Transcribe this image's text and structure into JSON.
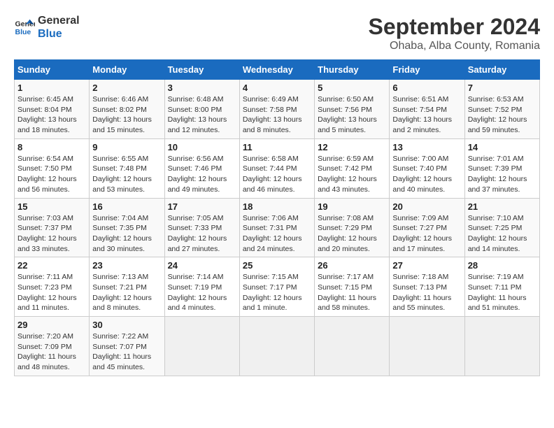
{
  "logo": {
    "line1": "General",
    "line2": "Blue"
  },
  "title": "September 2024",
  "subtitle": "Ohaba, Alba County, Romania",
  "days_header": [
    "Sunday",
    "Monday",
    "Tuesday",
    "Wednesday",
    "Thursday",
    "Friday",
    "Saturday"
  ],
  "weeks": [
    [
      {
        "day": "1",
        "sunrise": "Sunrise: 6:45 AM",
        "sunset": "Sunset: 8:04 PM",
        "daylight": "Daylight: 13 hours and 18 minutes."
      },
      {
        "day": "2",
        "sunrise": "Sunrise: 6:46 AM",
        "sunset": "Sunset: 8:02 PM",
        "daylight": "Daylight: 13 hours and 15 minutes."
      },
      {
        "day": "3",
        "sunrise": "Sunrise: 6:48 AM",
        "sunset": "Sunset: 8:00 PM",
        "daylight": "Daylight: 13 hours and 12 minutes."
      },
      {
        "day": "4",
        "sunrise": "Sunrise: 6:49 AM",
        "sunset": "Sunset: 7:58 PM",
        "daylight": "Daylight: 13 hours and 8 minutes."
      },
      {
        "day": "5",
        "sunrise": "Sunrise: 6:50 AM",
        "sunset": "Sunset: 7:56 PM",
        "daylight": "Daylight: 13 hours and 5 minutes."
      },
      {
        "day": "6",
        "sunrise": "Sunrise: 6:51 AM",
        "sunset": "Sunset: 7:54 PM",
        "daylight": "Daylight: 13 hours and 2 minutes."
      },
      {
        "day": "7",
        "sunrise": "Sunrise: 6:53 AM",
        "sunset": "Sunset: 7:52 PM",
        "daylight": "Daylight: 12 hours and 59 minutes."
      }
    ],
    [
      {
        "day": "8",
        "sunrise": "Sunrise: 6:54 AM",
        "sunset": "Sunset: 7:50 PM",
        "daylight": "Daylight: 12 hours and 56 minutes."
      },
      {
        "day": "9",
        "sunrise": "Sunrise: 6:55 AM",
        "sunset": "Sunset: 7:48 PM",
        "daylight": "Daylight: 12 hours and 53 minutes."
      },
      {
        "day": "10",
        "sunrise": "Sunrise: 6:56 AM",
        "sunset": "Sunset: 7:46 PM",
        "daylight": "Daylight: 12 hours and 49 minutes."
      },
      {
        "day": "11",
        "sunrise": "Sunrise: 6:58 AM",
        "sunset": "Sunset: 7:44 PM",
        "daylight": "Daylight: 12 hours and 46 minutes."
      },
      {
        "day": "12",
        "sunrise": "Sunrise: 6:59 AM",
        "sunset": "Sunset: 7:42 PM",
        "daylight": "Daylight: 12 hours and 43 minutes."
      },
      {
        "day": "13",
        "sunrise": "Sunrise: 7:00 AM",
        "sunset": "Sunset: 7:40 PM",
        "daylight": "Daylight: 12 hours and 40 minutes."
      },
      {
        "day": "14",
        "sunrise": "Sunrise: 7:01 AM",
        "sunset": "Sunset: 7:39 PM",
        "daylight": "Daylight: 12 hours and 37 minutes."
      }
    ],
    [
      {
        "day": "15",
        "sunrise": "Sunrise: 7:03 AM",
        "sunset": "Sunset: 7:37 PM",
        "daylight": "Daylight: 12 hours and 33 minutes."
      },
      {
        "day": "16",
        "sunrise": "Sunrise: 7:04 AM",
        "sunset": "Sunset: 7:35 PM",
        "daylight": "Daylight: 12 hours and 30 minutes."
      },
      {
        "day": "17",
        "sunrise": "Sunrise: 7:05 AM",
        "sunset": "Sunset: 7:33 PM",
        "daylight": "Daylight: 12 hours and 27 minutes."
      },
      {
        "day": "18",
        "sunrise": "Sunrise: 7:06 AM",
        "sunset": "Sunset: 7:31 PM",
        "daylight": "Daylight: 12 hours and 24 minutes."
      },
      {
        "day": "19",
        "sunrise": "Sunrise: 7:08 AM",
        "sunset": "Sunset: 7:29 PM",
        "daylight": "Daylight: 12 hours and 20 minutes."
      },
      {
        "day": "20",
        "sunrise": "Sunrise: 7:09 AM",
        "sunset": "Sunset: 7:27 PM",
        "daylight": "Daylight: 12 hours and 17 minutes."
      },
      {
        "day": "21",
        "sunrise": "Sunrise: 7:10 AM",
        "sunset": "Sunset: 7:25 PM",
        "daylight": "Daylight: 12 hours and 14 minutes."
      }
    ],
    [
      {
        "day": "22",
        "sunrise": "Sunrise: 7:11 AM",
        "sunset": "Sunset: 7:23 PM",
        "daylight": "Daylight: 12 hours and 11 minutes."
      },
      {
        "day": "23",
        "sunrise": "Sunrise: 7:13 AM",
        "sunset": "Sunset: 7:21 PM",
        "daylight": "Daylight: 12 hours and 8 minutes."
      },
      {
        "day": "24",
        "sunrise": "Sunrise: 7:14 AM",
        "sunset": "Sunset: 7:19 PM",
        "daylight": "Daylight: 12 hours and 4 minutes."
      },
      {
        "day": "25",
        "sunrise": "Sunrise: 7:15 AM",
        "sunset": "Sunset: 7:17 PM",
        "daylight": "Daylight: 12 hours and 1 minute."
      },
      {
        "day": "26",
        "sunrise": "Sunrise: 7:17 AM",
        "sunset": "Sunset: 7:15 PM",
        "daylight": "Daylight: 11 hours and 58 minutes."
      },
      {
        "day": "27",
        "sunrise": "Sunrise: 7:18 AM",
        "sunset": "Sunset: 7:13 PM",
        "daylight": "Daylight: 11 hours and 55 minutes."
      },
      {
        "day": "28",
        "sunrise": "Sunrise: 7:19 AM",
        "sunset": "Sunset: 7:11 PM",
        "daylight": "Daylight: 11 hours and 51 minutes."
      }
    ],
    [
      {
        "day": "29",
        "sunrise": "Sunrise: 7:20 AM",
        "sunset": "Sunset: 7:09 PM",
        "daylight": "Daylight: 11 hours and 48 minutes."
      },
      {
        "day": "30",
        "sunrise": "Sunrise: 7:22 AM",
        "sunset": "Sunset: 7:07 PM",
        "daylight": "Daylight: 11 hours and 45 minutes."
      },
      null,
      null,
      null,
      null,
      null
    ]
  ]
}
